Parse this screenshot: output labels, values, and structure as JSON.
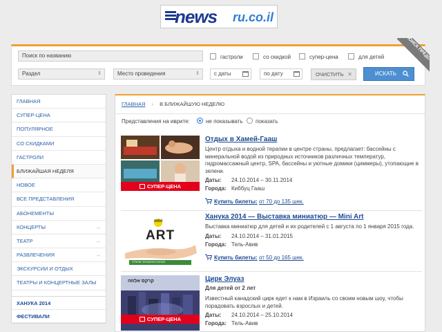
{
  "logo": {
    "word": "news",
    "domain": "ru.co.il"
  },
  "ribbon": {
    "text": "ПОИСК ПРЕДСТАВЛЕНИЯ:"
  },
  "search": {
    "name_placeholder": "Поиск по названию",
    "checkboxes": [
      "гастроли",
      "со скидкой",
      "супер-цена",
      "для детей"
    ],
    "section": "Раздел",
    "venue": "Место проведения",
    "date_from": "с даты",
    "date_to": "по дату",
    "clear": "ОЧИСТИТЬ",
    "submit": "ИСКАТЬ"
  },
  "sidebar": {
    "items": [
      {
        "label": "ГЛАВНАЯ"
      },
      {
        "label": "СУПЕР-ЦЕНА"
      },
      {
        "label": "ПОПУЛЯРНОЕ"
      },
      {
        "label": "СО СКИДКАМИ"
      },
      {
        "label": "ГАСТРОЛИ"
      },
      {
        "label": "БЛИЖАЙШАЯ НЕДЕЛЯ"
      },
      {
        "label": "НОВОЕ"
      },
      {
        "label": "ВСЕ ПРЕДСТАВЛЕНИЯ"
      },
      {
        "label": "АБОНЕМЕНТЫ"
      },
      {
        "label": "КОНЦЕРТЫ"
      },
      {
        "label": "ТЕАТР"
      },
      {
        "label": "РАЗВЛЕЧЕНИЯ"
      },
      {
        "label": "ЭКСКУРСИИ И ОТДЫХ"
      },
      {
        "label": "ТЕАТРЫ И КОНЦЕРТНЫЕ ЗАЛЫ"
      }
    ],
    "special": [
      {
        "label": "ХАНУКА 2014"
      },
      {
        "label": "ФЕСТИВАЛИ"
      }
    ]
  },
  "breadcrumb": {
    "home": "ГЛАВНАЯ",
    "sep": "›",
    "current": "В БЛИЖАЙШУЮ НЕДЕЛЮ"
  },
  "hebrew": {
    "label": "Представления на иврите:",
    "opt_hide": "не показывать",
    "opt_show": "показать"
  },
  "badge": "СУПЕР-ЦЕНА",
  "mini_art_logo": {
    "mini": "mini",
    "art": "ART",
    "hebrew_strip": "תערוכת מיניאטורות ישראלית"
  },
  "circus_banner": "קרקס אלוזה",
  "events": [
    {
      "title": "Отдых в Хамей-Гааш",
      "desc": "Центр отдыха и водной терапии в центре страны, предлагает: бассейны с минеральной водой из природных источников различных температур, гидромассажный центр, SPA, бассейны и уютные домики (циммеры), утопающие в зелени.",
      "dates_k": "Даты:",
      "dates": "24.10.2014 – 30.11.2014",
      "city_k": "Города:",
      "city": "Киббуц Гааш",
      "buy": "Купить билеты:",
      "price": "от 70 до 135 шек."
    },
    {
      "title": "Ханука 2014 — Выставка миниатюр — Mini Art",
      "desc": "Выставка миниатюр для детей и их родителей с 1 августа по 1 января 2015 года.",
      "dates_k": "Даты:",
      "dates": "24.10.2014 – 31.01.2015",
      "city_k": "Города:",
      "city": "Тель-Авив",
      "buy": "Купить билеты:",
      "price": "от 50 до 165 шек."
    },
    {
      "title": "Цирк Элуаз",
      "subtitle": "Для детей от 2 лет",
      "desc": "Известный канадский цирк едет к нам в Израиль со своим новым шоу, чтобы порадовать взрослых и детей.",
      "dates_k": "Даты:",
      "dates": "24.10.2014 – 25.10.2014",
      "city_k": "Города:",
      "city": "Тель-Авив"
    }
  ]
}
